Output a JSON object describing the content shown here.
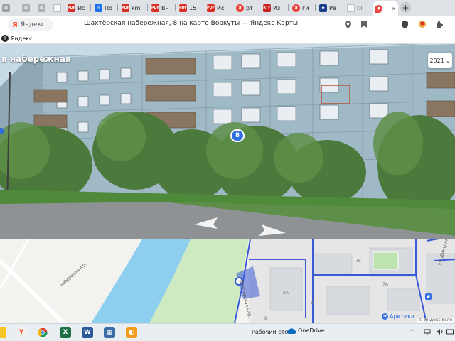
{
  "browser": {
    "tabs": [
      {
        "label": "Иc",
        "icon": "pdf-icon"
      },
      {
        "label": "По",
        "icon": "mail-icon"
      },
      {
        "label": "km",
        "icon": "pdf-icon"
      },
      {
        "label": "Вн",
        "icon": "pdf-icon"
      },
      {
        "label": "15",
        "icon": "pdf-icon"
      },
      {
        "label": "Иc",
        "icon": "pdf-icon"
      },
      {
        "label": "рт",
        "icon": "search-icon"
      },
      {
        "label": "Из",
        "icon": "rtf-icon"
      },
      {
        "label": "ги",
        "icon": "search-icon"
      },
      {
        "label": "Ре",
        "icon": "shield-icon"
      },
      {
        "label": "r.l",
        "icon": "page-icon"
      }
    ],
    "active_tab": {
      "label": "",
      "icon": "maps-pin-icon"
    },
    "new_tab_label": "+",
    "address": {
      "logo_text": "Яндекс",
      "page_title": "Шахтёрская набережная, 8 на карте Воркуты — Яндекс Карты"
    },
    "bookmark": {
      "label": "Яндекс",
      "plus": "+"
    }
  },
  "panorama": {
    "street_title": "я набережная",
    "year_label": "2021",
    "year_chevron": "⌄",
    "house_number": "8"
  },
  "map": {
    "street_label_left": "набережная р.",
    "street_label_mid": "Шахтёрская наб.",
    "street_label_right": "ул. Дмитрия",
    "house_labels": [
      "7Б",
      "8А",
      "7А",
      "8",
      "8"
    ],
    "poi_label": "Арктика",
    "attribution": "© Яндекс  Усло"
  },
  "taskbar": {
    "desktop_label": "Рабочий стол",
    "onedrive_label": "OneDrive",
    "apps": [
      {
        "icon": "yandex-browser-icon",
        "glyph": "Y",
        "color": "#f0f0f0"
      },
      {
        "icon": "chrome-icon",
        "glyph": "",
        "color": "#f0f0f0"
      },
      {
        "icon": "excel-icon",
        "glyph": "X",
        "color": "#1e7145"
      },
      {
        "icon": "word-icon",
        "glyph": "W",
        "color": "#2b579a"
      },
      {
        "icon": "calculator-icon",
        "glyph": "▦",
        "color": "#3a6ea5"
      },
      {
        "icon": "paint-icon",
        "glyph": "◐",
        "color": "#f29c1f"
      }
    ]
  },
  "colors": {
    "tab_strip": "#dee1e6",
    "accent_blue": "#2f6fe0",
    "river": "#8ecff0",
    "park": "#cdeac0",
    "road_outline": "#3a59d6"
  }
}
